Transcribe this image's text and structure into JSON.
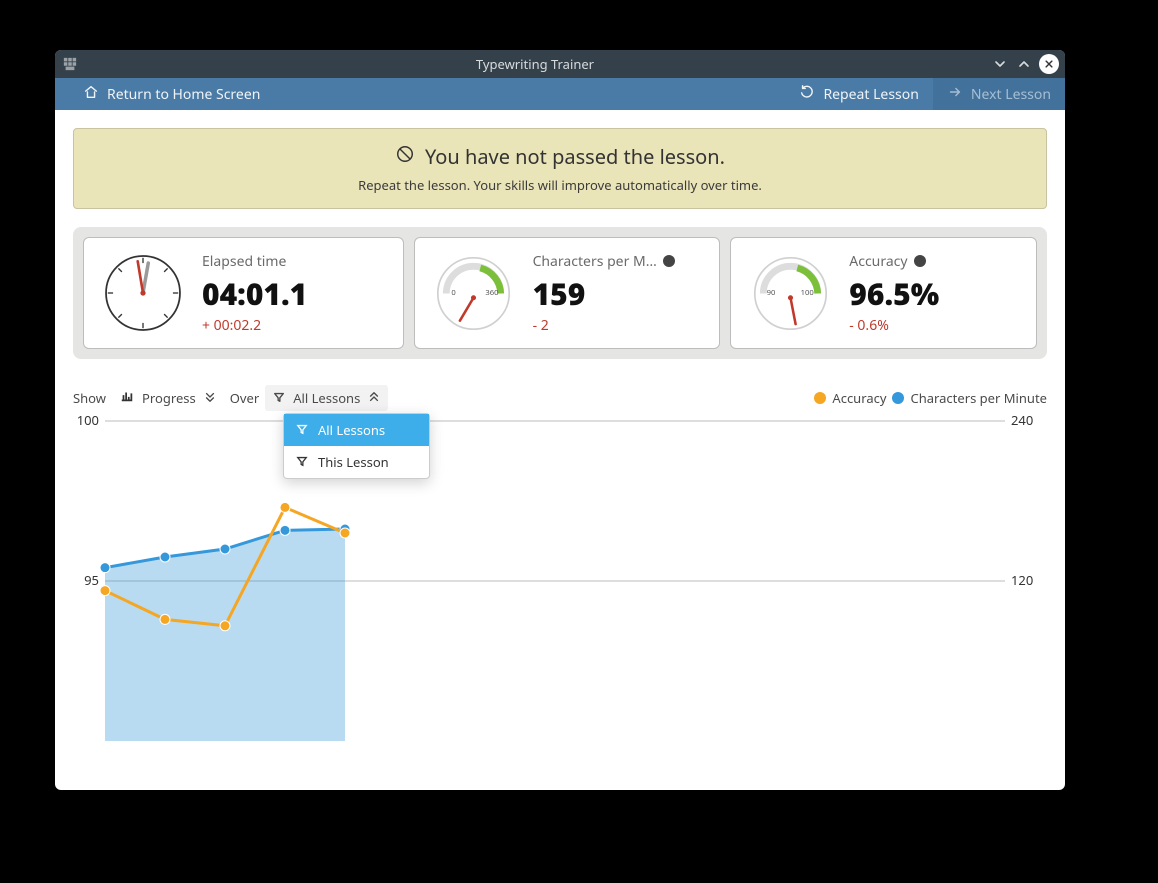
{
  "window": {
    "title": "Typewriting Trainer"
  },
  "toolbar": {
    "home": "Return to Home Screen",
    "repeat": "Repeat Lesson",
    "next": "Next Lesson"
  },
  "banner": {
    "title": "You have not passed the lesson.",
    "subtitle": "Repeat the lesson. Your skills will improve automatically over time."
  },
  "stats": {
    "elapsed": {
      "label": "Elapsed time",
      "value": "04:01.1",
      "delta": "+ 00:02.2"
    },
    "cpm": {
      "label": "Characters per M…",
      "value": "159",
      "delta": "- 2",
      "gauge": {
        "min": "0",
        "max": "360"
      }
    },
    "acc": {
      "label": "Accuracy",
      "value": "96.5%",
      "delta": "- 0.6%",
      "gauge": {
        "min": "90",
        "max": "100"
      }
    }
  },
  "controls": {
    "show": "Show",
    "progress": "Progress",
    "over": "Over",
    "filter": "All Lessons",
    "menu": {
      "all": "All Lessons",
      "this": "This Lesson"
    },
    "legend": {
      "a": "Accuracy",
      "b": "Characters per Minute"
    }
  },
  "chart_data": {
    "type": "line",
    "x": [
      1,
      2,
      3,
      4,
      5
    ],
    "series": [
      {
        "name": "Accuracy",
        "values": [
          94.7,
          93.8,
          93.6,
          97.3,
          96.5
        ]
      },
      {
        "name": "Characters per Minute",
        "values": [
          130,
          138,
          144,
          158,
          159
        ]
      }
    ],
    "y_left": {
      "label": "Accuracy",
      "lim": [
        90,
        100
      ],
      "ticks": [
        95,
        100
      ]
    },
    "y_right": {
      "label": "Characters per Minute",
      "lim": [
        0,
        240
      ],
      "ticks": [
        120,
        240
      ]
    },
    "fill_series": "Characters per Minute",
    "colors": {
      "Accuracy": "#f5a623",
      "Characters per Minute": "#3498db"
    }
  }
}
